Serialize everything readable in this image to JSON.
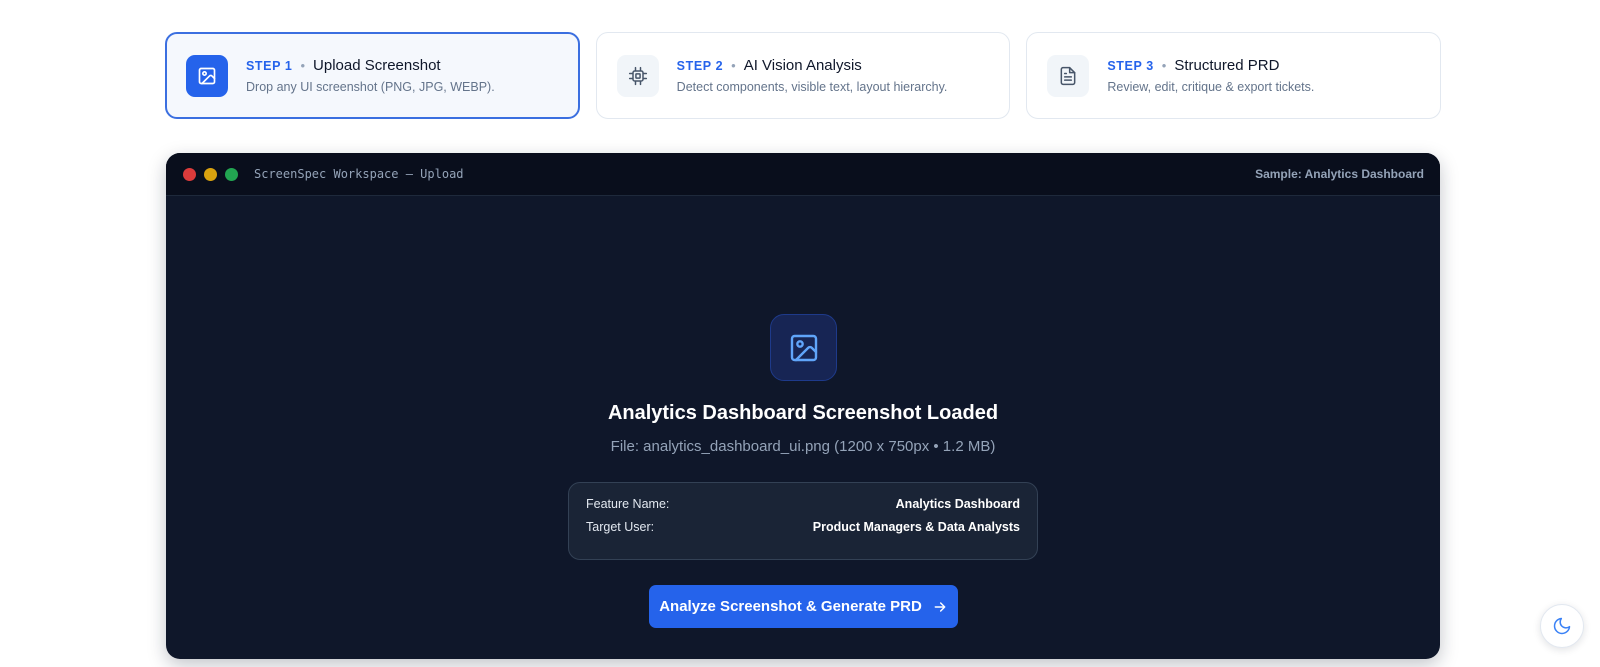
{
  "steps": [
    {
      "number": "STEP 1",
      "title": "Upload Screenshot",
      "desc": "Drop any UI screenshot (PNG, JPG, WEBP).",
      "icon": "image-icon",
      "active": true
    },
    {
      "number": "STEP 2",
      "title": "AI Vision Analysis",
      "desc": "Detect components, visible text, layout hierarchy.",
      "icon": "cpu-icon",
      "active": false
    },
    {
      "number": "STEP 3",
      "title": "Structured PRD",
      "desc": "Review, edit, critique & export tickets.",
      "icon": "document-icon",
      "active": false
    }
  ],
  "workspace": {
    "window_title": "ScreenSpec Workspace — Upload",
    "sample_label": "Sample: Analytics Dashboard",
    "headline": "Analytics Dashboard Screenshot Loaded",
    "file_info": "File: analytics_dashboard_ui.png (1200 x 750px • 1.2 MB)",
    "meta": {
      "feature_label": "Feature Name:",
      "feature_value": "Analytics Dashboard",
      "user_label": "Target User:",
      "user_value": "Product Managers & Data Analysts"
    },
    "cta_label": "Analyze Screenshot & Generate PRD"
  },
  "theme_toggle": {
    "icon": "moon-icon"
  },
  "colors": {
    "accent": "#2563eb",
    "workspace_bg": "#0f172a",
    "titlebar_bg": "#090e1c"
  }
}
